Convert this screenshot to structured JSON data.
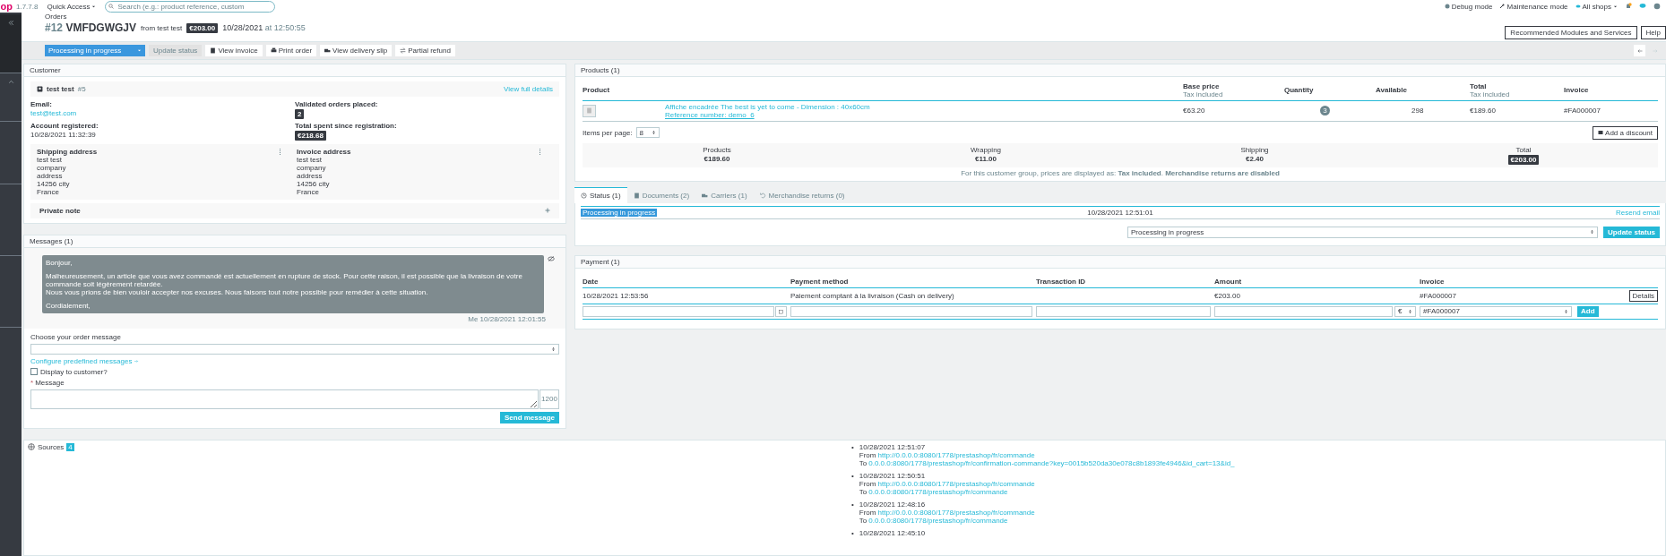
{
  "top_bar": {
    "logo": "op",
    "version": "1.7.7.8",
    "quick_access": "Quick Access",
    "search": {
      "placeholder": "Search (e.g.: product reference, custom"
    },
    "links": [
      "Debug mode",
      "Maintenance mode",
      "All shops"
    ]
  },
  "header": {
    "breadcrumb": "Orders",
    "order_number": "#12",
    "reference": "VMFDGWGJV",
    "from": "from test test",
    "total": "€203.00",
    "date": "10/28/2021",
    "at": "at",
    "time": "12:50:55",
    "buttons": [
      "Recommended Modules and Services",
      "Help"
    ]
  },
  "toolbar": {
    "status": "Processing in progress",
    "buttons": [
      {
        "label": "Update status",
        "disabled": true
      },
      {
        "label": "View invoice",
        "disabled": false
      },
      {
        "label": "Print order",
        "disabled": false
      },
      {
        "label": "View delivery slip",
        "disabled": false
      },
      {
        "label": "Partial refund",
        "disabled": false
      }
    ]
  },
  "customer": {
    "title": "Customer",
    "name": "test test",
    "id": "#5",
    "details_link": "View full details",
    "email_label": "Email:",
    "email": "test@test.com",
    "registered_label": "Account registered:",
    "registered": "10/28/2021 11:32:39",
    "orders_label": "Validated orders placed:",
    "orders": "2",
    "spent_label": "Total spent since registration:",
    "spent": "€218.68",
    "addresses": [
      {
        "title": "Shipping address",
        "lines": [
          "test test",
          "company",
          "address",
          "14256 city",
          "France"
        ]
      },
      {
        "title": "Invoice address",
        "lines": [
          "test test",
          "company",
          "address",
          "14256 city",
          "France"
        ]
      }
    ],
    "private_note": "Private note"
  },
  "messages": {
    "title": "Messages (1)",
    "items": [
      {
        "paragraphs": [
          [
            "Bonjour,"
          ],
          [
            "Malheureusement, un article que vous avez commandé est actuellement en rupture de stock. Pour cette raison, il est possible que la livraison de votre commande soit légèrement retardée.",
            "Nous vous prions de bien vouloir accepter nos excuses. Nous faisons tout notre possible pour remédier à cette situation."
          ],
          [
            "Cordialement,"
          ]
        ],
        "meta": "Me 10/28/2021 12:01:55"
      }
    ],
    "choose_label": "Choose your order message",
    "configure_link": "Configure predefined messages",
    "display": {
      "label": "Display to customer?",
      "checked": false
    },
    "message_label": {
      "mark": "*",
      "text": "Message",
      "required": true
    },
    "counter": "1200",
    "send": "Send message"
  },
  "products": {
    "title": "Products (1)",
    "columns": [
      {
        "label": "Product"
      },
      {
        "label": "Base price",
        "sub": "Tax included"
      },
      {
        "label": "Quantity"
      },
      {
        "label": "Available"
      },
      {
        "label": "Total",
        "sub": "Tax included"
      },
      {
        "label": "Invoice"
      }
    ],
    "rows": [
      {
        "name": "Affiche encadrée The best is yet to come - Dimension : 40x60cm",
        "reference": "Reference number: demo_6",
        "base_price": "€63.20",
        "quantity": "3",
        "available": "298",
        "total": "€189.60",
        "invoice": "#FA000007"
      }
    ],
    "items_per_page_label": "Items per page:",
    "items_per_page": "8",
    "add_discount": "Add a discount",
    "summary": [
      {
        "label": "Products",
        "value": "€189.60",
        "kind": "plain"
      },
      {
        "label": "Wrapping",
        "value": "€11.00",
        "kind": "plain"
      },
      {
        "label": "Shipping",
        "value": "€2.40",
        "kind": "plain"
      },
      {
        "label": "Total",
        "value": "€203.00",
        "kind": "badge"
      }
    ],
    "note": "For this customer group, prices are displayed as: **Tax included**. **Merchandise returns are disabled**"
  },
  "tabs": [
    {
      "label": "Status (1)",
      "selected": true
    },
    {
      "label": "Documents (2)",
      "selected": false
    },
    {
      "label": "Carriers (1)",
      "selected": false
    },
    {
      "label": "Merchandise returns (0)",
      "selected": false
    }
  ],
  "status": {
    "history": [
      {
        "status": "Processing in progress",
        "color": "#3498db",
        "date": "10/28/2021 12:51:01",
        "action": "Resend email"
      }
    ],
    "select": "Processing in progress",
    "button": "Update status"
  },
  "payment": {
    "title": "Payment (1)",
    "columns": [
      "Date",
      "Payment method",
      "Transaction ID",
      "Amount",
      "Invoice"
    ],
    "rows": [
      {
        "date": "10/28/2021 12:53:56",
        "method": "Paiement comptant à la livraison (Cash on delivery)",
        "amount": "€203.00",
        "invoice": "#FA000007",
        "button": "Details"
      }
    ],
    "form": {
      "currency": "€",
      "invoice": "#FA000007",
      "button": "Add"
    }
  },
  "sources": {
    "title": "Sources",
    "count": "4",
    "entries": [
      {
        "bullet": "•",
        "time": "10/28/2021 12:51:07",
        "from_label": "From",
        "from": "http://0.0.0.0:8080/1778/prestashop/fr/commande",
        "to_label": "To",
        "to": "0.0.0.0:8080/1778/prestashop/fr/confirmation-commande?key=0015b520da30e078c8b1893fe4946&id_cart=13&id_"
      },
      {
        "bullet": "•",
        "time": "10/28/2021 12:50:51",
        "from_label": "From",
        "from": "http://0.0.0.0:8080/1778/prestashop/fr/commande",
        "to_label": "To",
        "to": "0.0.0.0:8080/1778/prestashop/fr/commande"
      },
      {
        "bullet": "•",
        "time": "10/28/2021 12:48:16",
        "from_label": "From",
        "from": "http://0.0.0.0:8080/1778/prestashop/fr/commande",
        "to_label": "To",
        "to": "0.0.0.0:8080/1778/prestashop/fr/commande"
      },
      {
        "bullet": "•",
        "time": "10/28/2021 12:45:10"
      }
    ]
  }
}
